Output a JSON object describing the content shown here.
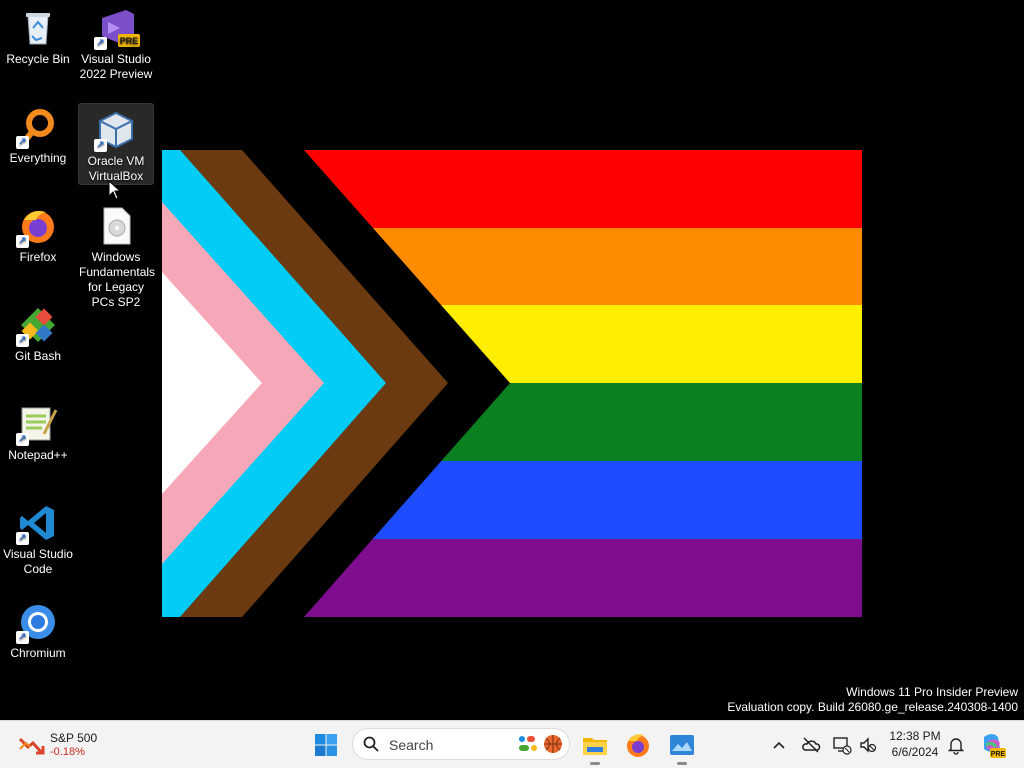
{
  "desktop": {
    "icons": [
      {
        "label": "Recycle Bin"
      },
      {
        "label": "Visual Studio 2022 Preview",
        "badge": "PRE"
      },
      {
        "label": "Everything"
      },
      {
        "label": "Oracle VM VirtualBox"
      },
      {
        "label": "Firefox"
      },
      {
        "label": "Windows Fundamentals for Legacy PCs SP2"
      },
      {
        "label": "Git Bash"
      },
      {
        "label": "Notepad++"
      },
      {
        "label": "Visual Studio Code"
      },
      {
        "label": "Chromium"
      }
    ]
  },
  "watermark": {
    "line1": "Windows 11 Pro Insider Preview",
    "line2": "Evaluation copy. Build 26080.ge_release.240308-1400"
  },
  "taskbar": {
    "widget": {
      "title": "S&P 500",
      "change": "-0.18%"
    },
    "search": {
      "placeholder": "Search"
    },
    "clock": {
      "time": "12:38 PM",
      "date": "6/6/2024"
    },
    "copilot_badge": "PRE"
  },
  "colors": {
    "taskbar_bg": "#f3f3f3",
    "flag_red": "#ff0000",
    "flag_orange": "#ff8c00",
    "flag_yellow": "#ffee00",
    "flag_green": "#0a8020",
    "flag_blue": "#1e4dff",
    "flag_purple": "#7e0e8e",
    "flag_black": "#000000",
    "flag_brown": "#6b3a10",
    "flag_lightblue": "#00ccf5",
    "flag_pink": "#f7a8b8",
    "flag_white": "#ffffff"
  }
}
